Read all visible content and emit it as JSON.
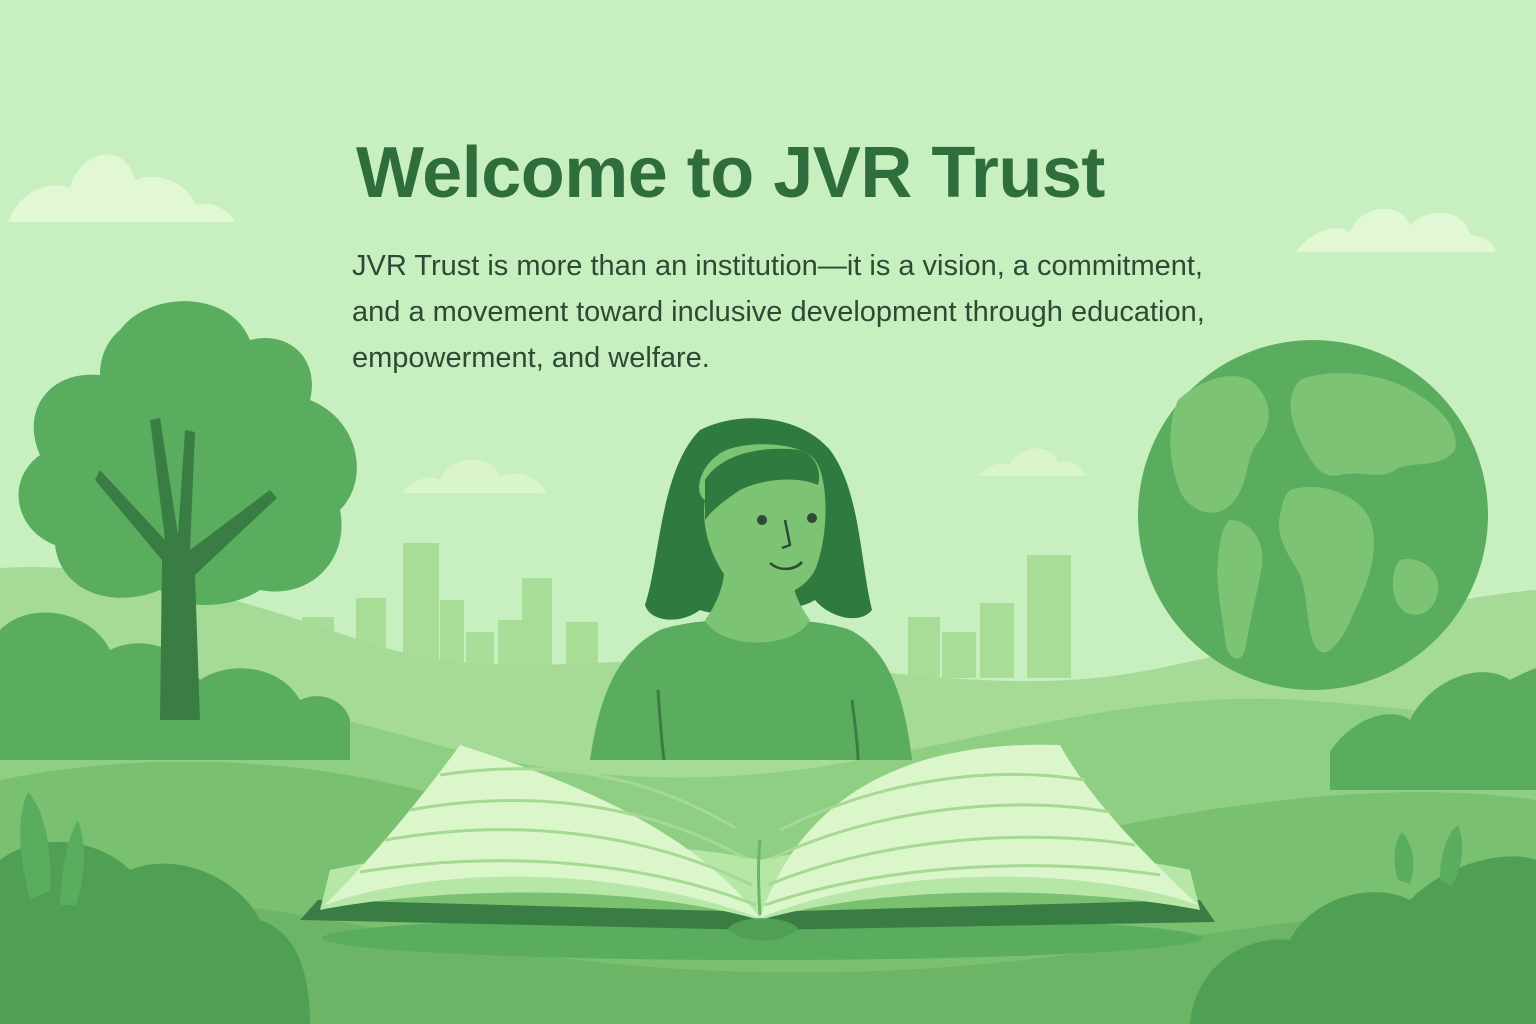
{
  "hero": {
    "title": "Welcome to JVR Trust",
    "description": "JVR Trust is more than an institution—it is a vision, a commitment, and a movement toward inclusive development through education, empowerment, and welfare."
  },
  "palette": {
    "background": "#c8efc0",
    "title_color": "#2f6e3c",
    "text_color": "#2d4a34",
    "dark_green": "#3a7d44",
    "mid_green": "#5aad5f",
    "light_green": "#8fcf84",
    "page_green": "#e4f9d6"
  },
  "illustration": {
    "elements": [
      "cloud-icon",
      "tree-icon",
      "city-skyline",
      "globe-icon",
      "person-reading",
      "open-book-icon",
      "hills",
      "bushes"
    ]
  }
}
